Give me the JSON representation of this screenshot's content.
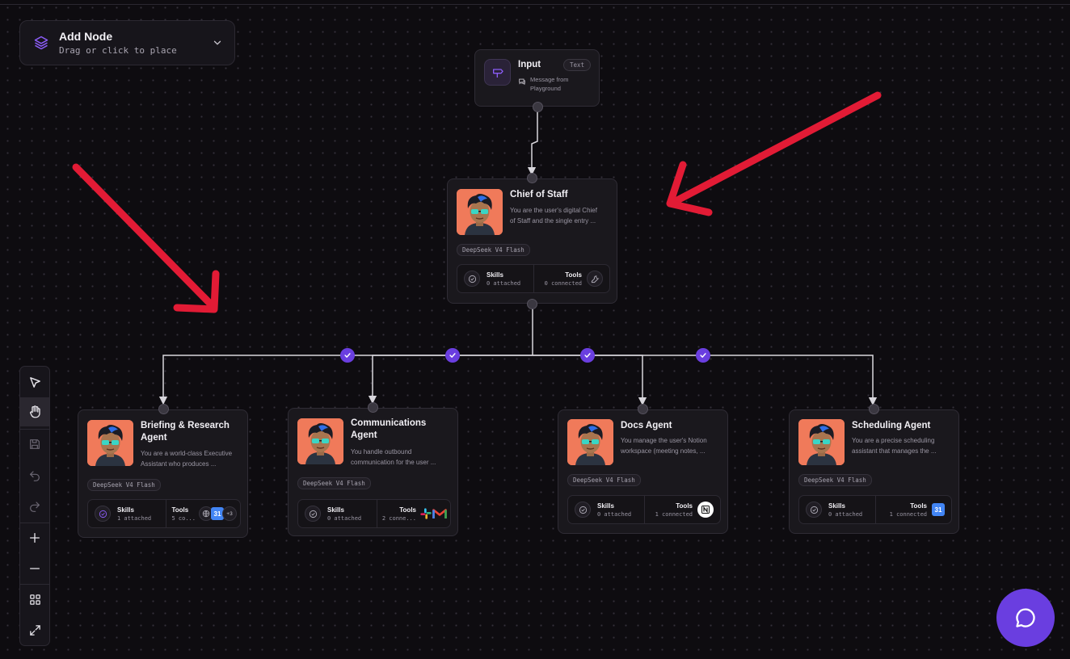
{
  "add_node": {
    "title": "Add Node",
    "subtitle": "Drag or click to place"
  },
  "input_node": {
    "title": "Input",
    "badge": "Text",
    "desc_line1": "Message from",
    "desc_line2": "Playground"
  },
  "chief": {
    "name": "Chief of Staff",
    "desc1": "You are the user's digital Chief",
    "desc2": "of Staff and the single entry ...",
    "model": "DeepSeek V4 Flash",
    "skills_label": "Skills",
    "skills_val": "0 attached",
    "tools_label": "Tools",
    "tools_val": "0 connected"
  },
  "agents": [
    {
      "name1": "Briefing & Research",
      "name2": "Agent",
      "desc1": "You are a world-class Executive",
      "desc2": "Assistant who produces ...",
      "model": "DeepSeek V4 Flash",
      "skills_label": "Skills",
      "skills_val": "1 attached",
      "tools_label": "Tools",
      "tools_val": "5 co...",
      "more": "+3"
    },
    {
      "name1": "Communications",
      "name2": "Agent",
      "desc1": "You handle outbound",
      "desc2": "communication for the user ...",
      "model": "DeepSeek V4 Flash",
      "skills_label": "Skills",
      "skills_val": "0 attached",
      "tools_label": "Tools",
      "tools_val": "2 conne..."
    },
    {
      "name1": "Docs Agent",
      "name2": "",
      "desc1": "You manage the user's Notion",
      "desc2": "workspace (meeting notes, ...",
      "model": "DeepSeek V4 Flash",
      "skills_label": "Skills",
      "skills_val": "0 attached",
      "tools_label": "Tools",
      "tools_val": "1 connected"
    },
    {
      "name1": "Scheduling Agent",
      "name2": "",
      "desc1": "You are a precise scheduling",
      "desc2": "assistant that manages the ...",
      "model": "DeepSeek V4 Flash",
      "skills_label": "Skills",
      "skills_val": "0 attached",
      "tools_label": "Tools",
      "tools_val": "1 connected"
    }
  ],
  "calendar_day": "31",
  "colors": {
    "accent": "#6a3ee0",
    "annotation_arrow": "#e21b35",
    "avatar_bg": "#f07a5a"
  }
}
